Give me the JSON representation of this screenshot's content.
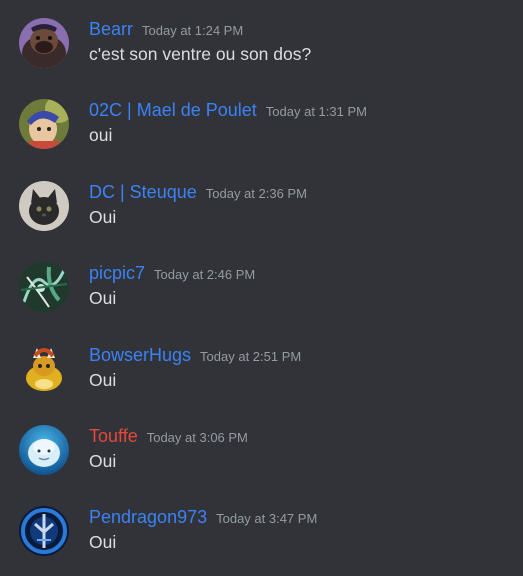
{
  "colors": {
    "background": "#313338",
    "username_blue": "#3b82f6",
    "username_red": "#e5483a",
    "timestamp": "#949ba4",
    "text": "#dbdee1"
  },
  "messages": [
    {
      "author": "Bearr",
      "author_color": "#3b82f6",
      "timestamp": "Today at 1:24 PM",
      "content": "c'est son ventre ou son dos?",
      "avatar_icon": "bear-avatar-icon"
    },
    {
      "author": "02C | Mael de Poulet",
      "author_color": "#3b82f6",
      "timestamp": "Today at 1:31 PM",
      "content": "oui",
      "avatar_icon": "cartoon-character-avatar-icon"
    },
    {
      "author": "DC | Steuque",
      "author_color": "#3b82f6",
      "timestamp": "Today at 2:36 PM",
      "content": "Oui",
      "avatar_icon": "black-cat-avatar-icon"
    },
    {
      "author": "picpic7",
      "author_color": "#3b82f6",
      "timestamp": "Today at 2:46 PM",
      "content": "Oui",
      "avatar_icon": "dragon-art-avatar-icon"
    },
    {
      "author": "BowserHugs",
      "author_color": "#3b82f6",
      "timestamp": "Today at 2:51 PM",
      "content": "Oui",
      "avatar_icon": "bowser-avatar-icon"
    },
    {
      "author": "Touffe",
      "author_color": "#e5483a",
      "timestamp": "Today at 3:06 PM",
      "content": "Oui",
      "avatar_icon": "beluga-whale-avatar-icon"
    },
    {
      "author": "Pendragon973",
      "author_color": "#3b82f6",
      "timestamp": "Today at 3:47 PM",
      "content": "Oui",
      "avatar_icon": "blue-emblem-avatar-icon"
    }
  ]
}
